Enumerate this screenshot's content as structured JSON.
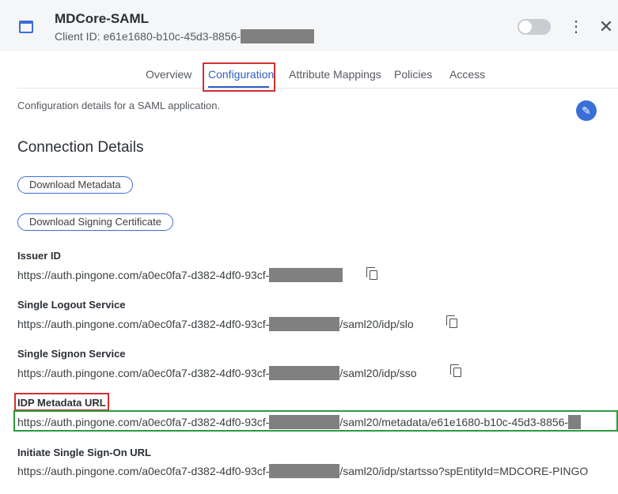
{
  "header": {
    "app_icon": "window-icon",
    "title": "MDCore-SAML",
    "client_id_prefix": "Client ID: e61e1680-b10c-45d3-8856-",
    "toggle_state": "off",
    "more_icon": "more-vertical-icon",
    "close_icon": "close-icon",
    "more_glyph": "⋮",
    "close_glyph": "✕"
  },
  "tabs": [
    {
      "label": "Overview",
      "active": false
    },
    {
      "label": "Configuration",
      "active": true
    },
    {
      "label": "Attribute Mappings",
      "active": false
    },
    {
      "label": "Policies",
      "active": false
    },
    {
      "label": "Access",
      "active": false
    }
  ],
  "content": {
    "description": "Configuration details for a SAML application.",
    "edit_icon": "pencil-icon",
    "edit_glyph": "✎",
    "section_title": "Connection Details",
    "download_metadata_label": "Download Metadata",
    "download_cert_label": "Download Signing Certificate",
    "fields": [
      {
        "label": "Issuer ID",
        "value_prefix": "https://auth.pingone.com/a0ec0fa7-d382-4df0-93cf-",
        "value_suffix": "",
        "copy_icon": "copy-icon"
      },
      {
        "label": "Single Logout Service",
        "value_prefix": "https://auth.pingone.com/a0ec0fa7-d382-4df0-93cf-",
        "value_suffix": "/saml20/idp/slo",
        "copy_icon": "copy-icon"
      },
      {
        "label": "Single Signon Service",
        "value_prefix": "https://auth.pingone.com/a0ec0fa7-d382-4df0-93cf-",
        "value_suffix": "/saml20/idp/sso",
        "copy_icon": "copy-icon"
      },
      {
        "label": "IDP Metadata URL",
        "value_prefix": "https://auth.pingone.com/a0ec0fa7-d382-4df0-93cf-",
        "value_suffix": "/saml20/metadata/e61e1680-b10c-45d3-8856-"
      },
      {
        "label": "Initiate Single Sign-On URL",
        "value_prefix": "https://auth.pingone.com/a0ec0fa7-d382-4df0-93cf-",
        "value_suffix": "/saml20/idp/startsso?spEntityId=MDCORE-PINGO"
      }
    ]
  },
  "colors": {
    "accent": "#3a6fd8",
    "highlight_red": "#d32f2f",
    "highlight_green": "#2e9a3e",
    "redaction": "#808080"
  }
}
